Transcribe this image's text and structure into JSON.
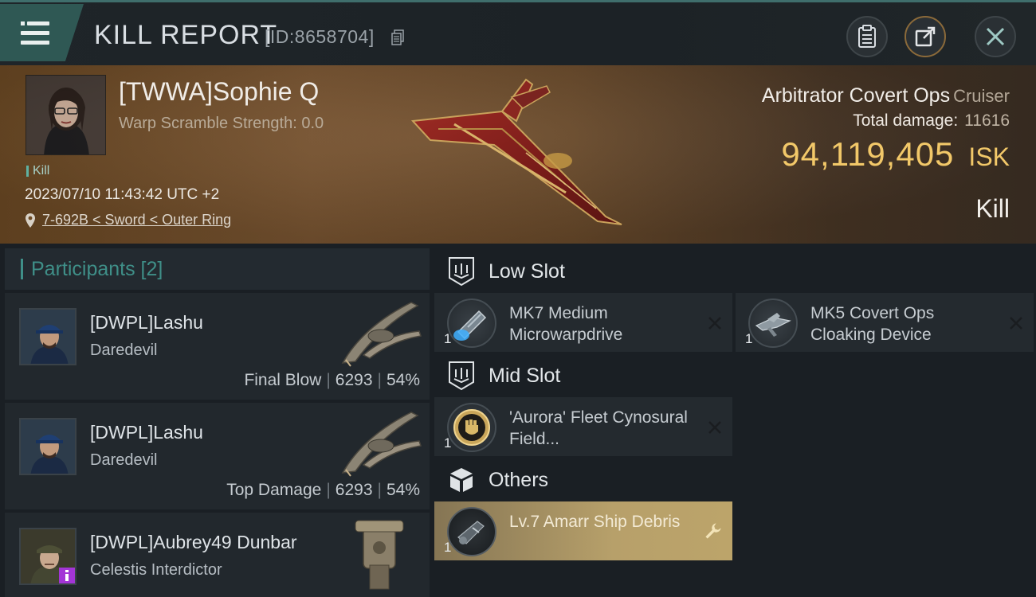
{
  "header": {
    "title": "KILL REPORT",
    "report_id": "[ID:8658704]",
    "buttons": [
      "clipboard-icon",
      "share-icon",
      "close-icon"
    ]
  },
  "victim": {
    "name": "[TWWA]Sophie Q",
    "warp_scramble": "Warp Scramble Strength: 0.0",
    "kill_tag": "Kill",
    "datetime": "2023/07/10 11:43:42 UTC +2",
    "location": "7-692B < Sword < Outer Ring",
    "ship_name": "Arbitrator Covert Ops",
    "ship_class": "Cruiser",
    "total_damage_label": "Total damage:",
    "total_damage": "11616",
    "isk_value": "94,119,405",
    "isk_unit": "ISK",
    "result": "Kill"
  },
  "participants": {
    "title": "Participants [2]",
    "items": [
      {
        "name": "[DWPL]Lashu",
        "ship": "Daredevil",
        "label": "Final Blow",
        "damage": "6293",
        "percent": "54%"
      },
      {
        "name": "[DWPL]Lashu",
        "ship": "Daredevil",
        "label": "Top Damage",
        "damage": "6293",
        "percent": "54%"
      },
      {
        "name": "[DWPL]Aubrey49 Dunbar",
        "ship": "Celestis Interdictor"
      }
    ]
  },
  "slots": {
    "low": {
      "title": "Low Slot",
      "modules": [
        {
          "name": "MK7 Medium Microwarpdrive",
          "qty": "1"
        },
        {
          "name": "MK5 Covert Ops Cloaking Device",
          "qty": "1"
        }
      ]
    },
    "mid": {
      "title": "Mid Slot",
      "modules": [
        {
          "name": "'Aurora' Fleet Cynosural Field...",
          "qty": "1"
        }
      ]
    },
    "others": {
      "title": "Others",
      "modules": [
        {
          "name": "Lv.7 Amarr Ship Debris",
          "qty": "1"
        }
      ]
    }
  },
  "colors": {
    "accent_teal": "#3f8f88",
    "isk_gold": "#f2c869",
    "hero_bronze": "#7b5632"
  }
}
